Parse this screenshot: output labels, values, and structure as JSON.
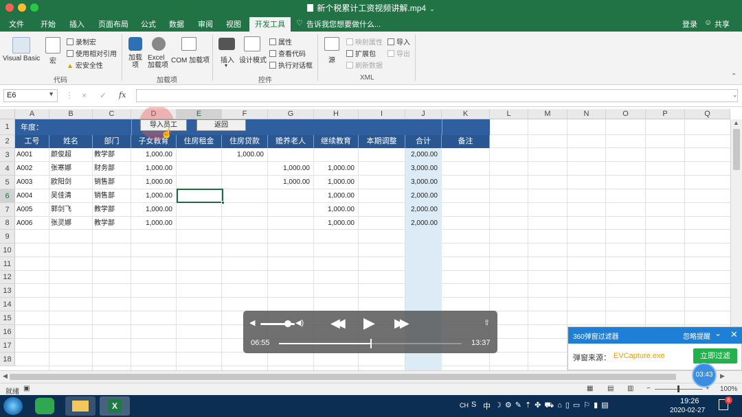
{
  "window": {
    "title": "新个税累计工资视频讲解.mp4"
  },
  "ribbon_tabs": [
    "文件",
    "开始",
    "插入",
    "页面布局",
    "公式",
    "数据",
    "审阅",
    "视图",
    "开发工具"
  ],
  "tell_me": "告诉我您想要做什么...",
  "account": {
    "login": "登录",
    "share": "共享"
  },
  "ribbon": {
    "code": {
      "visual_basic": "Visual Basic",
      "macro": "宏",
      "record_macro": "录制宏",
      "relative_ref": "使用相对引用",
      "macro_security": "宏安全性",
      "label": "代码"
    },
    "addins": {
      "addin": "加载项",
      "excel_addin": "Excel 加载项",
      "com_addin": "COM 加载项",
      "label": "加载项"
    },
    "controls": {
      "insert": "插入",
      "design_mode": "设计模式",
      "properties": "属性",
      "view_code": "查看代码",
      "run_dialog": "执行对话框",
      "label": "控件"
    },
    "xml": {
      "source": "源",
      "map_props": "映射属性",
      "expansion": "扩展包",
      "refresh": "刷新数据",
      "import": "导入",
      "export": "导出",
      "label": "XML"
    }
  },
  "formula_bar": {
    "name_box": "E6",
    "cancel": "×",
    "enter": "✓",
    "fx": "fx"
  },
  "columns": [
    "A",
    "B",
    "C",
    "D",
    "E",
    "F",
    "G",
    "H",
    "I",
    "J",
    "K",
    "L",
    "M",
    "N",
    "O",
    "P",
    "Q"
  ],
  "rows": [
    "1",
    "2",
    "3",
    "4",
    "5",
    "6",
    "7",
    "8",
    "9",
    "10",
    "11",
    "12",
    "13",
    "14",
    "15",
    "16",
    "17",
    "18"
  ],
  "sheet": {
    "year_label": "年度：",
    "import_button": "导入员工",
    "return_button": "返回",
    "headers": [
      "工号",
      "姓名",
      "部门",
      "子女教育",
      "住房租金",
      "住房贷款",
      "赡养老人",
      "继续教育",
      "本期调整",
      "合计",
      "备注"
    ],
    "data": [
      [
        "A001",
        "颜俊超",
        "教学部",
        "1,000.00",
        "",
        "1,000.00",
        "",
        "",
        "",
        "2,000.00",
        ""
      ],
      [
        "A002",
        "张寒娜",
        "财务部",
        "1,000.00",
        "",
        "",
        "1,000.00",
        "1,000.00",
        "",
        "3,000.00",
        ""
      ],
      [
        "A003",
        "欧阳剑",
        "销售部",
        "1,000.00",
        "",
        "",
        "1,000.00",
        "1,000.00",
        "",
        "3,000.00",
        ""
      ],
      [
        "A004",
        "吴佳清",
        "销售部",
        "1,000.00",
        "",
        "",
        "",
        "1,000.00",
        "",
        "2,000.00",
        ""
      ],
      [
        "A005",
        "郭剑飞",
        "教学部",
        "1,000.00",
        "",
        "",
        "",
        "1,000.00",
        "",
        "2,000.00",
        ""
      ],
      [
        "A006",
        "张灵娜",
        "教学部",
        "1,000.00",
        "",
        "",
        "",
        "1,000.00",
        "",
        "2,000.00",
        ""
      ]
    ]
  },
  "player": {
    "current_time": "06:55",
    "total_time": "13:37",
    "progress_fraction": 0.5
  },
  "popup": {
    "title": "360弹窗过滤器",
    "ignore": "忽略提醒",
    "source_label": "弹窗来源：",
    "source_value": "EVCapture.exe",
    "filter_button": "立即过滤"
  },
  "status": {
    "ready": "就绪",
    "zoom": "100%",
    "timer": "03:43"
  },
  "taskbar": {
    "time": "19:26",
    "date": "2020-02-27",
    "lang": "CH",
    "ime": "中",
    "notify_count": "6"
  },
  "colors": {
    "excel_green": "#217346",
    "header_blue": "#2f5f9e",
    "total_col": "#ddebf7"
  }
}
